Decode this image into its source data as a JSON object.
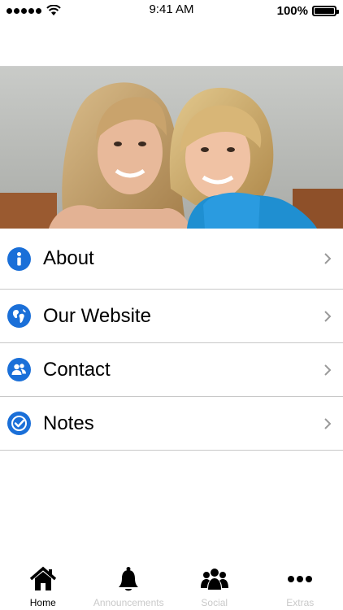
{
  "status_bar": {
    "time": "9:41 AM",
    "battery": "100%"
  },
  "colors": {
    "accent": "#1a6fd8",
    "tab_inactive": "#c9c9c9",
    "divider": "#c8c8c8"
  },
  "menu": {
    "items": [
      {
        "label": "About",
        "icon": "info-icon"
      },
      {
        "label": "Our Website",
        "icon": "globe-icon"
      },
      {
        "label": "Contact",
        "icon": "contacts-icon"
      },
      {
        "label": "Notes",
        "icon": "checkmark-icon"
      }
    ]
  },
  "tab_bar": {
    "tabs": [
      {
        "label": "Home",
        "icon": "home-icon",
        "active": true
      },
      {
        "label": "Announcements",
        "icon": "bell-icon",
        "active": false
      },
      {
        "label": "Social",
        "icon": "group-icon",
        "active": false
      },
      {
        "label": "Extras",
        "icon": "more-icon",
        "active": false
      }
    ]
  }
}
